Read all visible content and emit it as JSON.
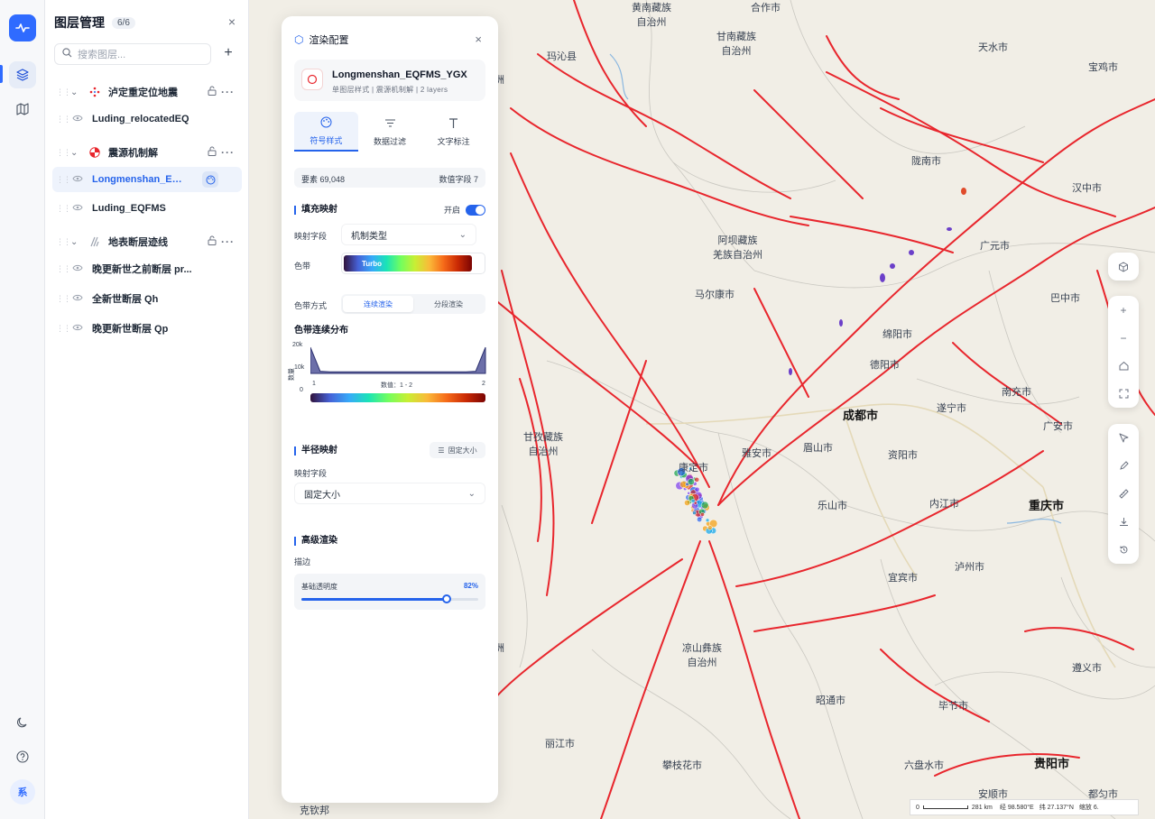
{
  "layer_panel": {
    "title": "图层管理",
    "count": "6/6",
    "search_placeholder": "搜索图层...",
    "add": "+",
    "close": "×",
    "groups": [
      {
        "label": "泸定重定位地震",
        "icon": "cluster-icon",
        "children": [
          {
            "label": "Luding_relocatedEQ"
          }
        ]
      },
      {
        "label": "震源机制解",
        "icon": "beachball-icon",
        "children": [
          {
            "label": "Longmenshan_EQF..."
          },
          {
            "label": "Luding_EQFMS"
          }
        ]
      },
      {
        "label": "地表断层迹线",
        "icon": "fault-icon",
        "children": [
          {
            "label": "晚更新世之前断层 pr..."
          },
          {
            "label": "全新世断层 Qh"
          },
          {
            "label": "晚更新世断层 Qp"
          }
        ]
      }
    ]
  },
  "rail": {
    "avatar": "系"
  },
  "config": {
    "title": "渲染配置",
    "layer_name": "Longmenshan_EQFMS_YGX",
    "layer_meta": "单图层样式 | 震源机制解 | 2 layers",
    "tabs": [
      "符号样式",
      "数据过滤",
      "文字标注"
    ],
    "stats_left": "要素 69,048",
    "stats_right": "数值字段 7",
    "fill_section": "填充映射",
    "fill_toggle_label": "开启",
    "map_field_label": "映射字段",
    "map_field_value": "机制类型",
    "ramp_label": "色带",
    "ramp_name": "Turbo",
    "ramp_mode_label": "色带方式",
    "ramp_modes": [
      "连续渲染",
      "分段渲染"
    ],
    "dist_title": "色带连续分布",
    "hist_y_ticks": [
      "20k",
      "10k",
      "0"
    ],
    "hist_y_label": "数量",
    "hist_x_min": "1",
    "hist_x_max": "2",
    "hist_range": "数值：1 - 2",
    "hist_bins": [
      17000,
      1400,
      1000,
      1000,
      1000,
      1000,
      1000,
      1000,
      1000,
      1000,
      1000,
      1000,
      1000,
      1000,
      1000,
      1000,
      1000,
      1400,
      17000
    ],
    "radius_section": "半径映射",
    "radius_fixed_btn": "固定大小",
    "radius_field_label": "映射字段",
    "radius_field_value": "固定大小",
    "adv_section": "高级渲染",
    "stroke_label": "描边",
    "opacity_label": "基础透明度",
    "opacity_value": "82%",
    "opacity": 0.82
  },
  "map": {
    "places": [
      {
        "t": "黄南藏族\n自治州"
      },
      {
        "t": "合作市"
      },
      {
        "t": "甘南藏族\n自治州"
      },
      {
        "t": "天水市"
      },
      {
        "t": "宝鸡市"
      },
      {
        "t": "玛沁县"
      },
      {
        "t": "陇南市"
      },
      {
        "t": "汉中市"
      },
      {
        "t": "阿坝藏族\n羌族自治州"
      },
      {
        "t": "广元市"
      },
      {
        "t": "马尔康市"
      },
      {
        "t": "巴中市"
      },
      {
        "t": "绵阳市"
      },
      {
        "t": "德阳市"
      },
      {
        "t": "南充市"
      },
      {
        "t": "成都市"
      },
      {
        "t": "遂宁市"
      },
      {
        "t": "广安市"
      },
      {
        "t": "甘孜藏族\n自治州"
      },
      {
        "t": "雅安市"
      },
      {
        "t": "眉山市"
      },
      {
        "t": "资阳市"
      },
      {
        "t": "康定市"
      },
      {
        "t": "乐山市"
      },
      {
        "t": "内江市"
      },
      {
        "t": "重庆市"
      },
      {
        "t": "泸州市"
      },
      {
        "t": "宜宾市"
      },
      {
        "t": "凉山彝族\n自治州"
      },
      {
        "t": "遵义市"
      },
      {
        "t": "昭通市"
      },
      {
        "t": "毕节市"
      },
      {
        "t": "丽江市"
      },
      {
        "t": "攀枝花市"
      },
      {
        "t": "六盘水市"
      },
      {
        "t": "贵阳市"
      },
      {
        "t": "安顺市"
      },
      {
        "t": "都匀市"
      },
      {
        "t": "克钦邦"
      },
      {
        "t": "洲"
      },
      {
        "t": "洲"
      }
    ],
    "scale": {
      "zero": "0",
      "distance": "281 km",
      "lon": "经 98.580°E",
      "lat": "纬 27.137°N",
      "zoom": "缩放 6."
    }
  },
  "colors": {
    "accent": "#2563eb",
    "fault": "#e8262d"
  }
}
